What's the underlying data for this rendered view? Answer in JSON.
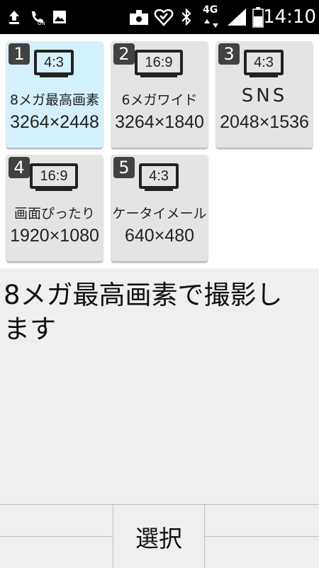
{
  "status_bar": {
    "time": "14:10",
    "network": "4G",
    "icons": [
      "upload-icon",
      "wifi-calling-icon",
      "image-icon",
      "camera-alert-icon",
      "heart-icon",
      "bluetooth-icon",
      "signal-icon",
      "battery-icon"
    ]
  },
  "tiles": [
    {
      "number": "1",
      "ratio": "4:3",
      "name": "8メガ最高画素",
      "resolution": "3264×2448",
      "selected": true
    },
    {
      "number": "2",
      "ratio": "16:9",
      "name": "6メガワイド",
      "resolution": "3264×1840",
      "selected": false
    },
    {
      "number": "3",
      "ratio": "4:3",
      "name": "SNS",
      "resolution": "2048×1536",
      "selected": false
    },
    {
      "number": "4",
      "ratio": "16:9",
      "name": "画面ぴったり",
      "resolution": "1920×1080",
      "selected": false
    },
    {
      "number": "5",
      "ratio": "4:3",
      "name": "ケータイメール",
      "resolution": "640×480",
      "selected": false
    }
  ],
  "description": "8メガ最高画素で撮影します",
  "softkeys": {
    "left": "",
    "center": "選択",
    "right": ""
  },
  "colors": {
    "selected_tile": "#d3f1fd",
    "tile": "#e4e4e4",
    "number_badge": "#424242"
  }
}
